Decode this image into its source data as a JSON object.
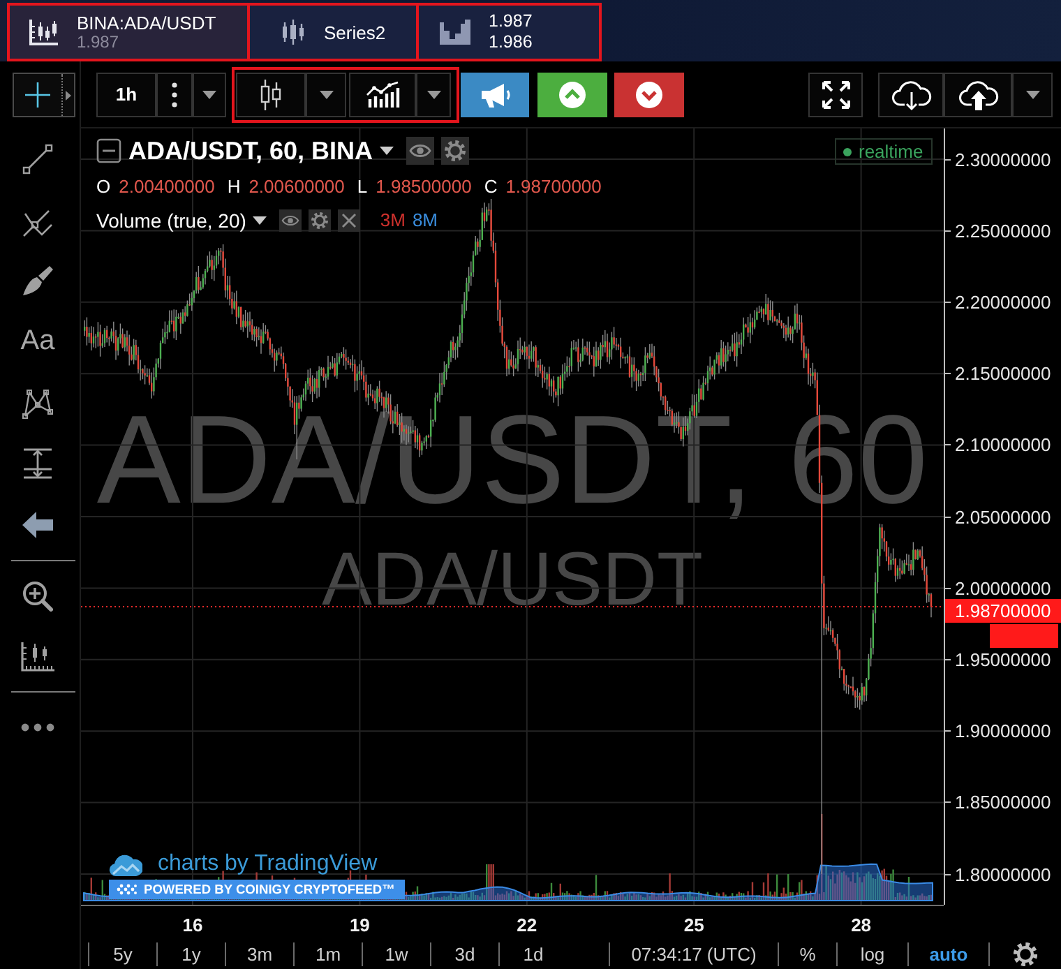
{
  "series_tabs": {
    "highlighted": true,
    "items": [
      {
        "kind": "symbol",
        "label": "BINA:ADA/USDT",
        "value": "1.987",
        "selected": true
      },
      {
        "kind": "series",
        "label": "Series2",
        "selected": false
      },
      {
        "kind": "quote",
        "values": [
          "1.987",
          "1.986"
        ],
        "selected": false
      }
    ]
  },
  "side_toolbar": {
    "groups": [
      [
        {
          "kind": "crosshair",
          "selected": true
        },
        {
          "kind": "trend-line",
          "selected": false
        },
        {
          "kind": "pitchfork",
          "selected": false
        },
        {
          "kind": "brush",
          "selected": false
        },
        {
          "kind": "text",
          "label": "Aa",
          "selected": false
        },
        {
          "kind": "pattern",
          "selected": false
        },
        {
          "kind": "measure",
          "selected": false
        },
        {
          "kind": "back",
          "selected": false
        }
      ],
      [
        {
          "kind": "zoom",
          "selected": false
        },
        {
          "kind": "ruler",
          "selected": false
        }
      ],
      [
        {
          "kind": "more",
          "selected": false
        }
      ]
    ]
  },
  "toolbar": {
    "interval": "1h",
    "style_group_highlighted": true
  },
  "legend": {
    "title": "ADA/USDT, 60, BINA",
    "status": "realtime",
    "ohlc": [
      {
        "label": "O",
        "value": "2.00400000"
      },
      {
        "label": "H",
        "value": "2.00600000"
      },
      {
        "label": "L",
        "value": "1.98500000"
      },
      {
        "label": "C",
        "value": "1.98700000"
      }
    ],
    "indicator": {
      "name": "Volume (true, 20)",
      "values": [
        {
          "text": "3M",
          "color": "#d0312d"
        },
        {
          "text": "8M",
          "color": "#3b8fe0"
        }
      ]
    }
  },
  "watermark": {
    "symbol_interval": "ADA/USDT, 60",
    "symbol": "ADA/USDT"
  },
  "branding": {
    "logo": "charts by TradingView",
    "banner": "POWERED BY COINIGY CRYPTOFEED™"
  },
  "price_axis": {
    "ticks": [
      "2.30000000",
      "2.25000000",
      "2.20000000",
      "2.15000000",
      "2.10000000",
      "2.05000000",
      "2.00000000",
      "1.95000000",
      "1.90000000",
      "1.85000000",
      "1.80000000"
    ],
    "last_price": "1.98700000"
  },
  "time_axis": {
    "ticks": [
      "16",
      "19",
      "22",
      "25",
      "28"
    ]
  },
  "bottom_bar": {
    "ranges": [
      "5y",
      "1y",
      "3m",
      "1m",
      "1w",
      "3d",
      "1d"
    ],
    "clock": "07:34:17 (UTC)",
    "scale_options": [
      {
        "label": "%",
        "selected": false
      },
      {
        "label": "log",
        "selected": false
      },
      {
        "label": "auto",
        "selected": true
      }
    ]
  }
}
